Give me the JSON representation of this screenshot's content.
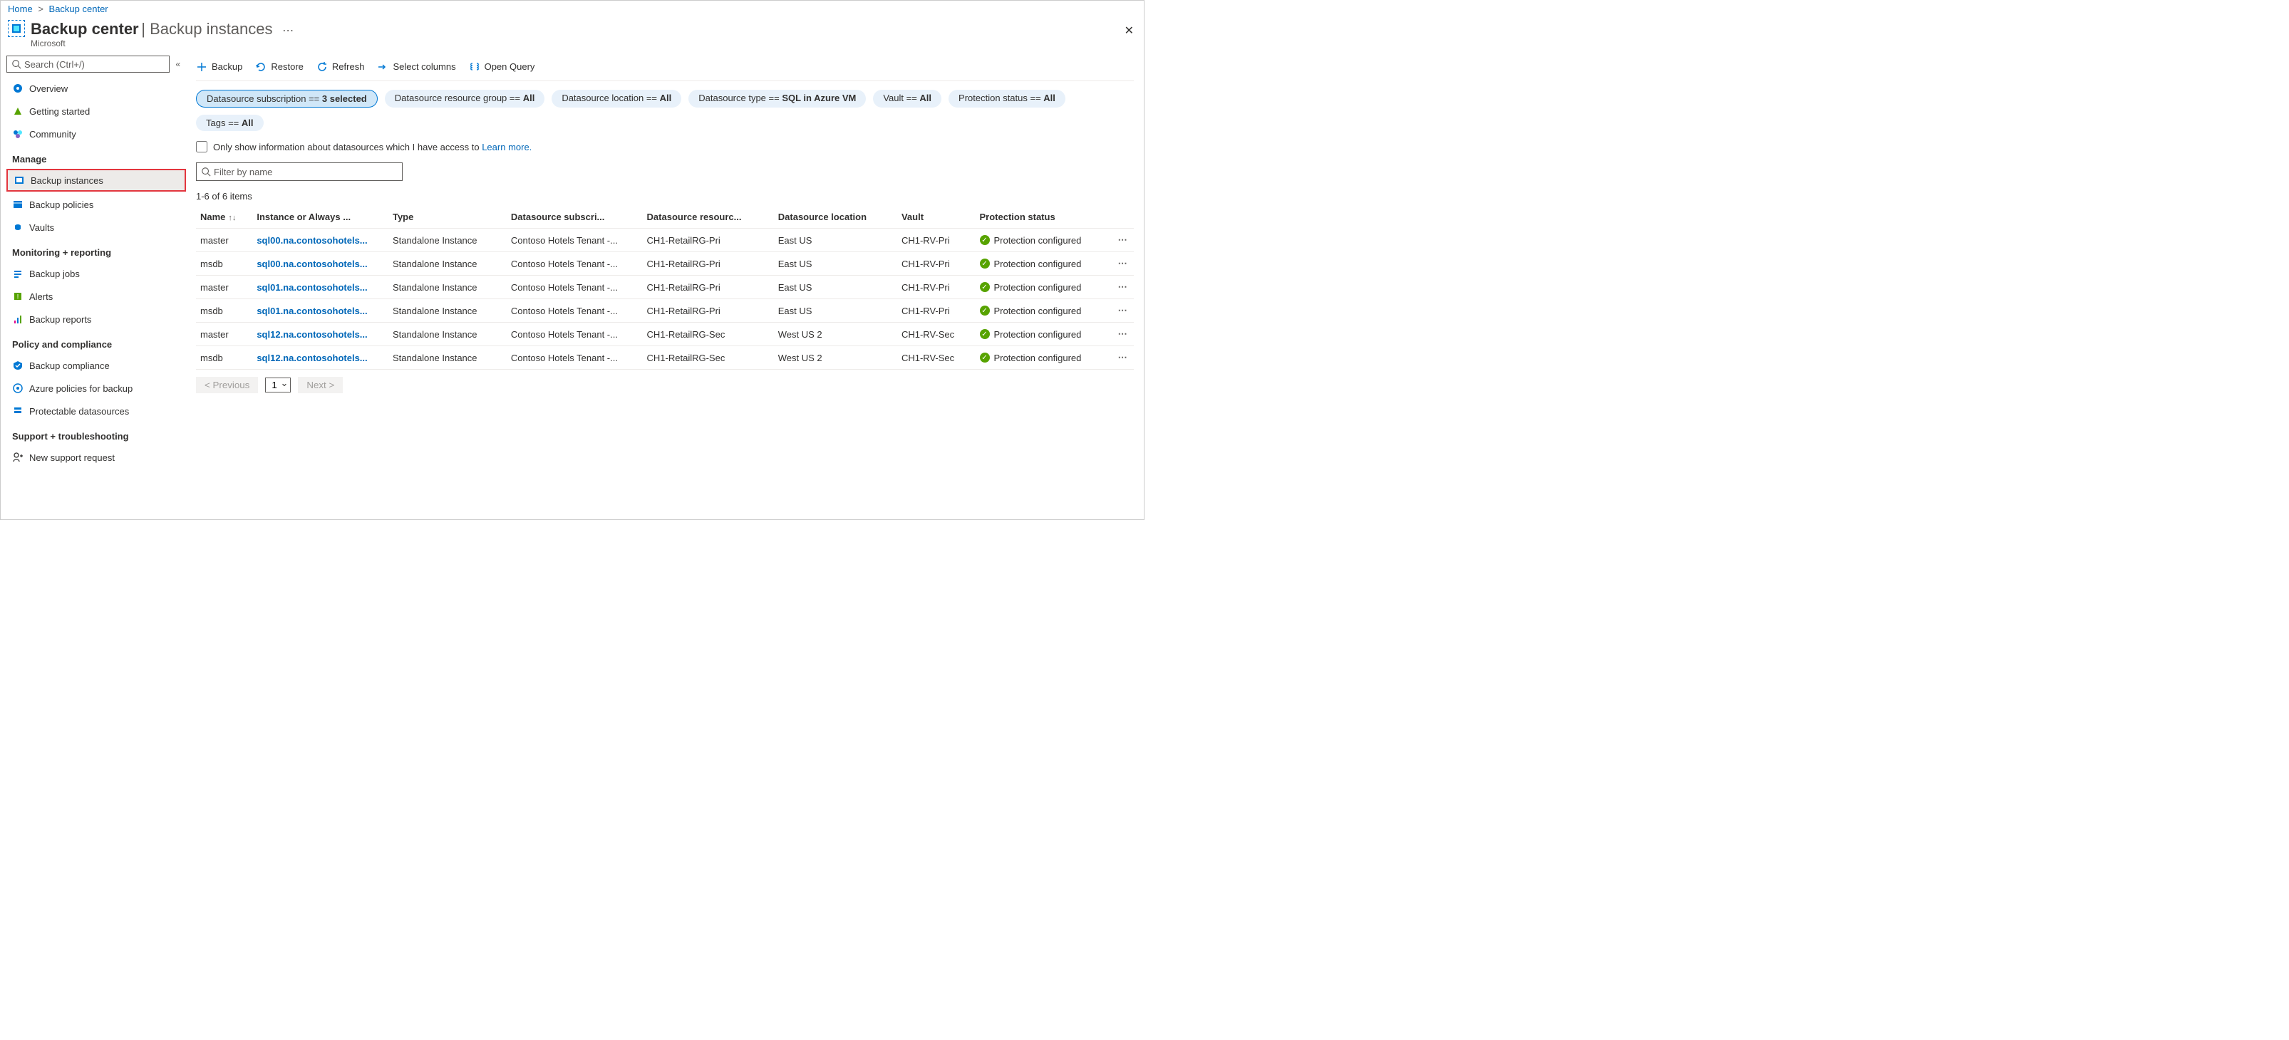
{
  "breadcrumb": {
    "home": "Home",
    "current": "Backup center"
  },
  "header": {
    "title": "Backup center",
    "subtitle": "Backup instances",
    "company": "Microsoft"
  },
  "sidebar": {
    "search_placeholder": "Search (Ctrl+/)",
    "top": [
      {
        "label": "Overview"
      },
      {
        "label": "Getting started"
      },
      {
        "label": "Community"
      }
    ],
    "sections": [
      {
        "title": "Manage",
        "items": [
          {
            "label": "Backup instances",
            "selected": true,
            "highlight": true
          },
          {
            "label": "Backup policies"
          },
          {
            "label": "Vaults"
          }
        ]
      },
      {
        "title": "Monitoring + reporting",
        "items": [
          {
            "label": "Backup jobs"
          },
          {
            "label": "Alerts"
          },
          {
            "label": "Backup reports"
          }
        ]
      },
      {
        "title": "Policy and compliance",
        "items": [
          {
            "label": "Backup compliance"
          },
          {
            "label": "Azure policies for backup"
          },
          {
            "label": "Protectable datasources"
          }
        ]
      },
      {
        "title": "Support + troubleshooting",
        "items": [
          {
            "label": "New support request"
          }
        ]
      }
    ]
  },
  "toolbar": {
    "backup": "Backup",
    "restore": "Restore",
    "refresh": "Refresh",
    "select_columns": "Select columns",
    "open_query": "Open Query"
  },
  "filters": {
    "subscription_label": "Datasource subscription == ",
    "subscription_value": "3 selected",
    "rg_label": "Datasource resource group == ",
    "rg_value": "All",
    "location_label": "Datasource location == ",
    "location_value": "All",
    "type_label": "Datasource type == ",
    "type_value": "SQL in Azure VM",
    "vault_label": "Vault == ",
    "vault_value": "All",
    "protection_label": "Protection status == ",
    "protection_value": "All",
    "tags_label": "Tags == ",
    "tags_value": "All"
  },
  "checkbox": {
    "label": "Only show information about datasources which I have access to ",
    "link": "Learn more."
  },
  "filter_input_placeholder": "Filter by name",
  "count_label": "1-6 of 6 items",
  "columns": {
    "name": "Name",
    "instance": "Instance or Always ...",
    "type": "Type",
    "subscription": "Datasource subscri...",
    "rg": "Datasource resourc...",
    "location": "Datasource location",
    "vault": "Vault",
    "status": "Protection status"
  },
  "rows": [
    {
      "name": "master",
      "instance": "sql00.na.contosohotels...",
      "type": "Standalone Instance",
      "sub": "Contoso Hotels Tenant -...",
      "rg": "CH1-RetailRG-Pri",
      "loc": "East US",
      "vault": "CH1-RV-Pri",
      "status": "Protection configured"
    },
    {
      "name": "msdb",
      "instance": "sql00.na.contosohotels...",
      "type": "Standalone Instance",
      "sub": "Contoso Hotels Tenant -...",
      "rg": "CH1-RetailRG-Pri",
      "loc": "East US",
      "vault": "CH1-RV-Pri",
      "status": "Protection configured"
    },
    {
      "name": "master",
      "instance": "sql01.na.contosohotels...",
      "type": "Standalone Instance",
      "sub": "Contoso Hotels Tenant -...",
      "rg": "CH1-RetailRG-Pri",
      "loc": "East US",
      "vault": "CH1-RV-Pri",
      "status": "Protection configured"
    },
    {
      "name": "msdb",
      "instance": "sql01.na.contosohotels...",
      "type": "Standalone Instance",
      "sub": "Contoso Hotels Tenant -...",
      "rg": "CH1-RetailRG-Pri",
      "loc": "East US",
      "vault": "CH1-RV-Pri",
      "status": "Protection configured"
    },
    {
      "name": "master",
      "instance": "sql12.na.contosohotels...",
      "type": "Standalone Instance",
      "sub": "Contoso Hotels Tenant -...",
      "rg": "CH1-RetailRG-Sec",
      "loc": "West US 2",
      "vault": "CH1-RV-Sec",
      "status": "Protection configured"
    },
    {
      "name": "msdb",
      "instance": "sql12.na.contosohotels...",
      "type": "Standalone Instance",
      "sub": "Contoso Hotels Tenant -...",
      "rg": "CH1-RetailRG-Sec",
      "loc": "West US 2",
      "vault": "CH1-RV-Sec",
      "status": "Protection configured"
    }
  ],
  "pager": {
    "prev": "< Previous",
    "page": "1",
    "next": "Next >"
  }
}
